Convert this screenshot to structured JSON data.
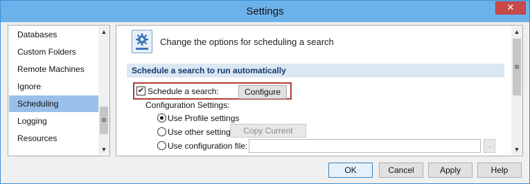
{
  "window": {
    "title": "Settings",
    "close_glyph": "✕"
  },
  "nav": {
    "items": [
      {
        "label": "Databases",
        "selected": false
      },
      {
        "label": "Custom Folders",
        "selected": false
      },
      {
        "label": "Remote Machines",
        "selected": false
      },
      {
        "label": "Ignore",
        "selected": false
      },
      {
        "label": "Scheduling",
        "selected": true
      },
      {
        "label": "Logging",
        "selected": false
      },
      {
        "label": "Resources",
        "selected": false
      }
    ]
  },
  "panel": {
    "header_text": "Change the options for scheduling a search",
    "section_title": "Schedule a search to run automatically",
    "schedule_checkbox": {
      "label": "Schedule a search:",
      "checked": true,
      "check_glyph": "✔"
    },
    "configure_button": "Configure",
    "config_settings_label": "Configuration Settings:",
    "options": {
      "profile": {
        "label": "Use Profile settings",
        "selected": true
      },
      "other": {
        "label": "Use other settings:",
        "selected": false
      },
      "file": {
        "label": "Use configuration file:",
        "selected": false
      }
    },
    "copy_current_button": "Copy Current",
    "config_file_value": "",
    "browse_button": "...",
    "info_glyph": "i"
  },
  "footer": {
    "ok": "OK",
    "cancel": "Cancel",
    "apply": "Apply",
    "help": "Help"
  },
  "colors": {
    "titlebar": "#6db1ea",
    "nav_selected": "#99c0e8",
    "section_bar": "#dbe7f3",
    "section_text": "#133b6d",
    "highlight_border": "#b33b3b"
  },
  "icons": {
    "scroll_up": "▲",
    "scroll_down": "▼",
    "settings_page": "gear-icon"
  }
}
